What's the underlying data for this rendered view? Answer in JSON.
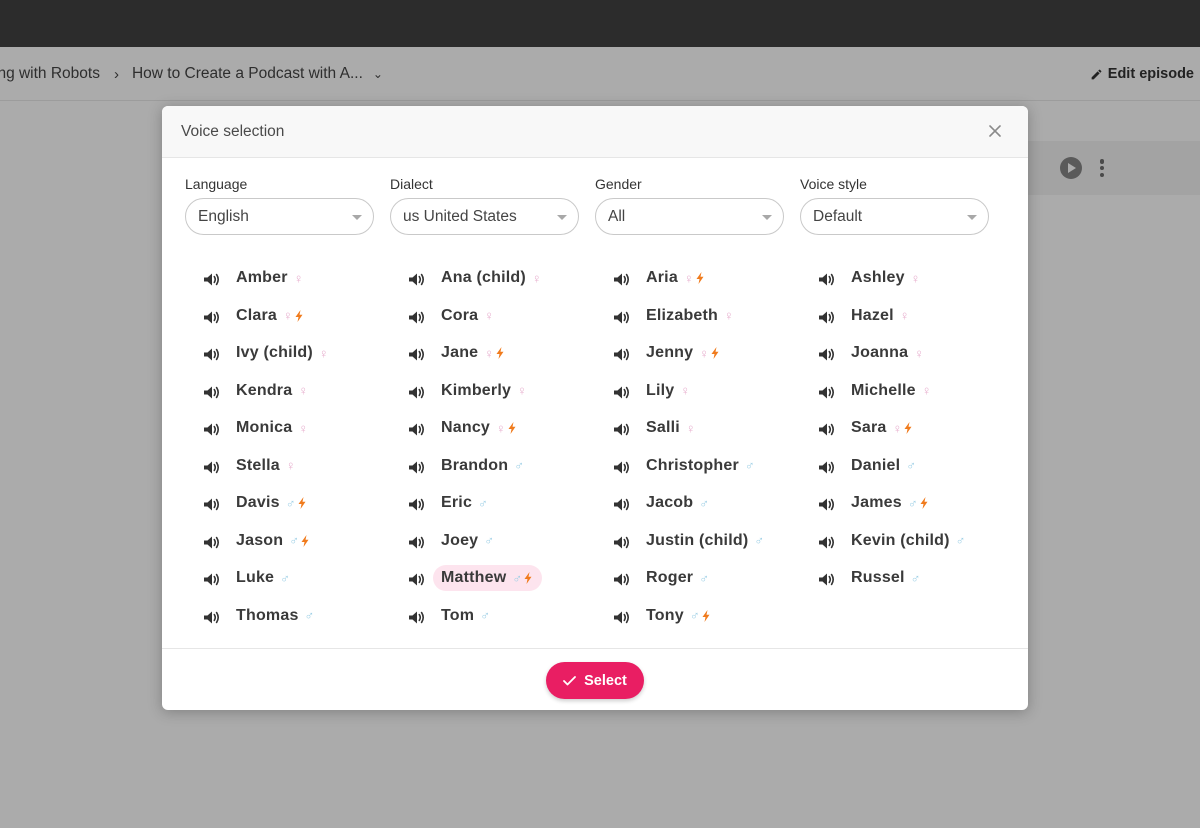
{
  "breadcrumb": {
    "parent": "ing with Robots",
    "separator": "›",
    "current": "How to Create a Podcast with A...",
    "caret": "⌄"
  },
  "header": {
    "edit_label": "Edit episode"
  },
  "modal": {
    "title": "Voice selection",
    "filters": [
      {
        "label": "Language",
        "value": "English"
      },
      {
        "label": "Dialect",
        "value": "us United States"
      },
      {
        "label": "Gender",
        "value": "All"
      },
      {
        "label": "Voice style",
        "value": "Default"
      }
    ],
    "columns": [
      [
        {
          "name": "Amber",
          "gender": "female",
          "neural": false
        },
        {
          "name": "Clara",
          "gender": "female",
          "neural": true
        },
        {
          "name": "Ivy (child)",
          "gender": "female",
          "neural": false
        },
        {
          "name": "Kendra",
          "gender": "female",
          "neural": false
        },
        {
          "name": "Monica",
          "gender": "female",
          "neural": false
        },
        {
          "name": "Stella",
          "gender": "female",
          "neural": false
        },
        {
          "name": "Davis",
          "gender": "male",
          "neural": true
        },
        {
          "name": "Jason",
          "gender": "male",
          "neural": true
        },
        {
          "name": "Luke",
          "gender": "male",
          "neural": false
        },
        {
          "name": "Thomas",
          "gender": "male",
          "neural": false
        }
      ],
      [
        {
          "name": "Ana (child)",
          "gender": "female",
          "neural": false
        },
        {
          "name": "Cora",
          "gender": "female",
          "neural": false
        },
        {
          "name": "Jane",
          "gender": "female",
          "neural": true
        },
        {
          "name": "Kimberly",
          "gender": "female",
          "neural": false
        },
        {
          "name": "Nancy",
          "gender": "female",
          "neural": true
        },
        {
          "name": "Brandon",
          "gender": "male",
          "neural": false
        },
        {
          "name": "Eric",
          "gender": "male",
          "neural": false
        },
        {
          "name": "Joey",
          "gender": "male",
          "neural": false
        },
        {
          "name": "Matthew",
          "gender": "male",
          "neural": true,
          "selected": true
        },
        {
          "name": "Tom",
          "gender": "male",
          "neural": false
        }
      ],
      [
        {
          "name": "Aria",
          "gender": "female",
          "neural": true
        },
        {
          "name": "Elizabeth",
          "gender": "female",
          "neural": false
        },
        {
          "name": "Jenny",
          "gender": "female",
          "neural": true
        },
        {
          "name": "Lily",
          "gender": "female",
          "neural": false
        },
        {
          "name": "Salli",
          "gender": "female",
          "neural": false
        },
        {
          "name": "Christopher",
          "gender": "male",
          "neural": false
        },
        {
          "name": "Jacob",
          "gender": "male",
          "neural": false
        },
        {
          "name": "Justin (child)",
          "gender": "male",
          "neural": false
        },
        {
          "name": "Roger",
          "gender": "male",
          "neural": false
        },
        {
          "name": "Tony",
          "gender": "male",
          "neural": true
        }
      ],
      [
        {
          "name": "Ashley",
          "gender": "female",
          "neural": false
        },
        {
          "name": "Hazel",
          "gender": "female",
          "neural": false
        },
        {
          "name": "Joanna",
          "gender": "female",
          "neural": false
        },
        {
          "name": "Michelle",
          "gender": "female",
          "neural": false
        },
        {
          "name": "Sara",
          "gender": "female",
          "neural": true
        },
        {
          "name": "Daniel",
          "gender": "male",
          "neural": false
        },
        {
          "name": "James",
          "gender": "male",
          "neural": true
        },
        {
          "name": "Kevin (child)",
          "gender": "male",
          "neural": false
        },
        {
          "name": "Russel",
          "gender": "male",
          "neural": false
        }
      ]
    ],
    "gender_symbols": {
      "female": "♀",
      "male": "♂"
    },
    "select_label": "Select",
    "colors": {
      "accent": "#e91e63",
      "female": "#e8b0cf",
      "male": "#9fd0e6",
      "bolt": "#f07b1d",
      "selected_bg": "#fde4ee"
    }
  }
}
